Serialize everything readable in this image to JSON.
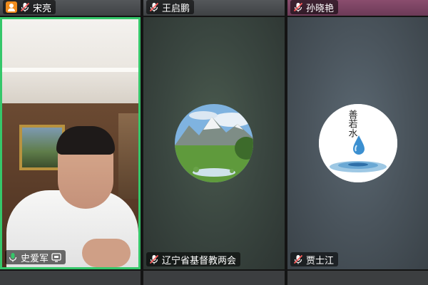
{
  "participants": {
    "top": [
      {
        "name": "宋亮",
        "mic": "muted"
      },
      {
        "name": "王启鹏",
        "mic": "muted"
      },
      {
        "name": "孙晓艳",
        "mic": "muted"
      }
    ],
    "main": [
      {
        "name": "史爱军",
        "mic": "active",
        "state": "video",
        "extra_icon": "screen-share-icon"
      },
      {
        "name": "辽宁省基督教两会",
        "mic": "muted",
        "state": "avatar",
        "avatar": "mountain-meadow-avatar"
      },
      {
        "name": "贾士江",
        "mic": "muted",
        "state": "avatar",
        "avatar": "water-drop-calligraphy-avatar",
        "avatar_text": "善若水"
      }
    ]
  },
  "colors": {
    "active_speaker_border": "#35c76a",
    "muted_icon": "#ff5b5b",
    "active_mic_icon": "#35c76a",
    "host_badge": "#f08c1c"
  }
}
